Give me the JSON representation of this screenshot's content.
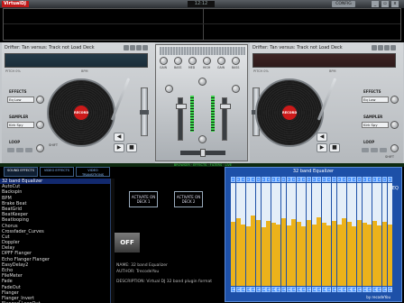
{
  "app": {
    "logo_text": "VirtualDJ",
    "clock": "12:12",
    "config_label": "CONFIG",
    "win_buttons": [
      "_",
      "▫",
      "x"
    ]
  },
  "deck_left": {
    "track_text": "Drifter: Tan versus: Track not Load Deck",
    "pitch_label": "PITCH 0%",
    "bpm_label": "BPM",
    "sections": {
      "effects": "EFFECTS",
      "sampler": "SAMPLER",
      "loop": "LOOP"
    },
    "effect_select": "Eq Low",
    "sampler_select": "Kirk Spy",
    "record_label": "RECORD",
    "transport": {
      "cue": "◀",
      "play": "▶",
      "stop": "■"
    },
    "shift_label": "SHIFT"
  },
  "deck_right": {
    "track_text": "Drifter: Tan versus: Track not Load Deck",
    "pitch_label": "PITCH 0%",
    "bpm_label": "BPM",
    "sections": {
      "effects": "EFFECTS",
      "sampler": "SAMPLER",
      "loop": "LOOP"
    },
    "effect_select": "Eq Low",
    "sampler_select": "Kirk Spy",
    "record_label": "RECORD",
    "transport": {
      "cue": "◀",
      "play": "▶",
      "stop": "■"
    },
    "shift_label": "SHIFT"
  },
  "mixer": {
    "eq_labels": [
      "GAIN",
      "BASS",
      "MED",
      "HIGH",
      "GAIN",
      "BASS"
    ]
  },
  "browser": {
    "status_text": "BROWSER · EFFECTS · FILTERS · LIVE",
    "tabs": [
      "SOUND EFFECTS",
      "VIDEO EFFECTS",
      "VIDEO TRANSITIONS"
    ],
    "effects": [
      "32 band Equalizer",
      "AutoCut",
      "Backspin",
      "BPM",
      "Brake Beat",
      "BeatGrid",
      "BeatKeeper",
      "Beatlooping",
      "Chorus",
      "Crossfader_Curves",
      "Cut",
      "Doppler",
      "Delay",
      "DPFF Flanger",
      "Echo Flanger Flanger",
      "EasyDelay2",
      "Echo",
      "FileMeter",
      "Fade",
      "FadeOut",
      "Flanger",
      "Flanger_Invert",
      "Flanged LoopOut"
    ],
    "selected_index": 0,
    "activate_deck1": "ACTIVATE ON DECK 1",
    "activate_deck2": "ACTIVATE ON DECK 2",
    "fx_logo": "OFF",
    "desc_name": "NAME: 32 band Equalizer",
    "desc_author": "AUTHOR: TrecodeYou",
    "desc_text": "DESCRIPTION: Virtual DJ 32 band plugin format"
  },
  "equalizer": {
    "title": "32 band Equalizer",
    "credit": "by recodeYou",
    "mark": "EQ",
    "band_top_label": "0",
    "band_bottom_label": "dB",
    "levels": [
      0.62,
      0.66,
      0.6,
      0.58,
      0.68,
      0.64,
      0.57,
      0.63,
      0.61,
      0.6,
      0.66,
      0.59,
      0.65,
      0.62,
      0.58,
      0.64,
      0.6,
      0.67,
      0.61,
      0.59,
      0.63,
      0.6,
      0.66,
      0.62,
      0.58,
      0.64,
      0.61,
      0.6,
      0.63,
      0.59,
      0.62,
      0.6
    ],
    "colors": {
      "fill": "#ecb21a",
      "panel": "#1d50a8",
      "band_cap": "#3b8bff"
    }
  }
}
